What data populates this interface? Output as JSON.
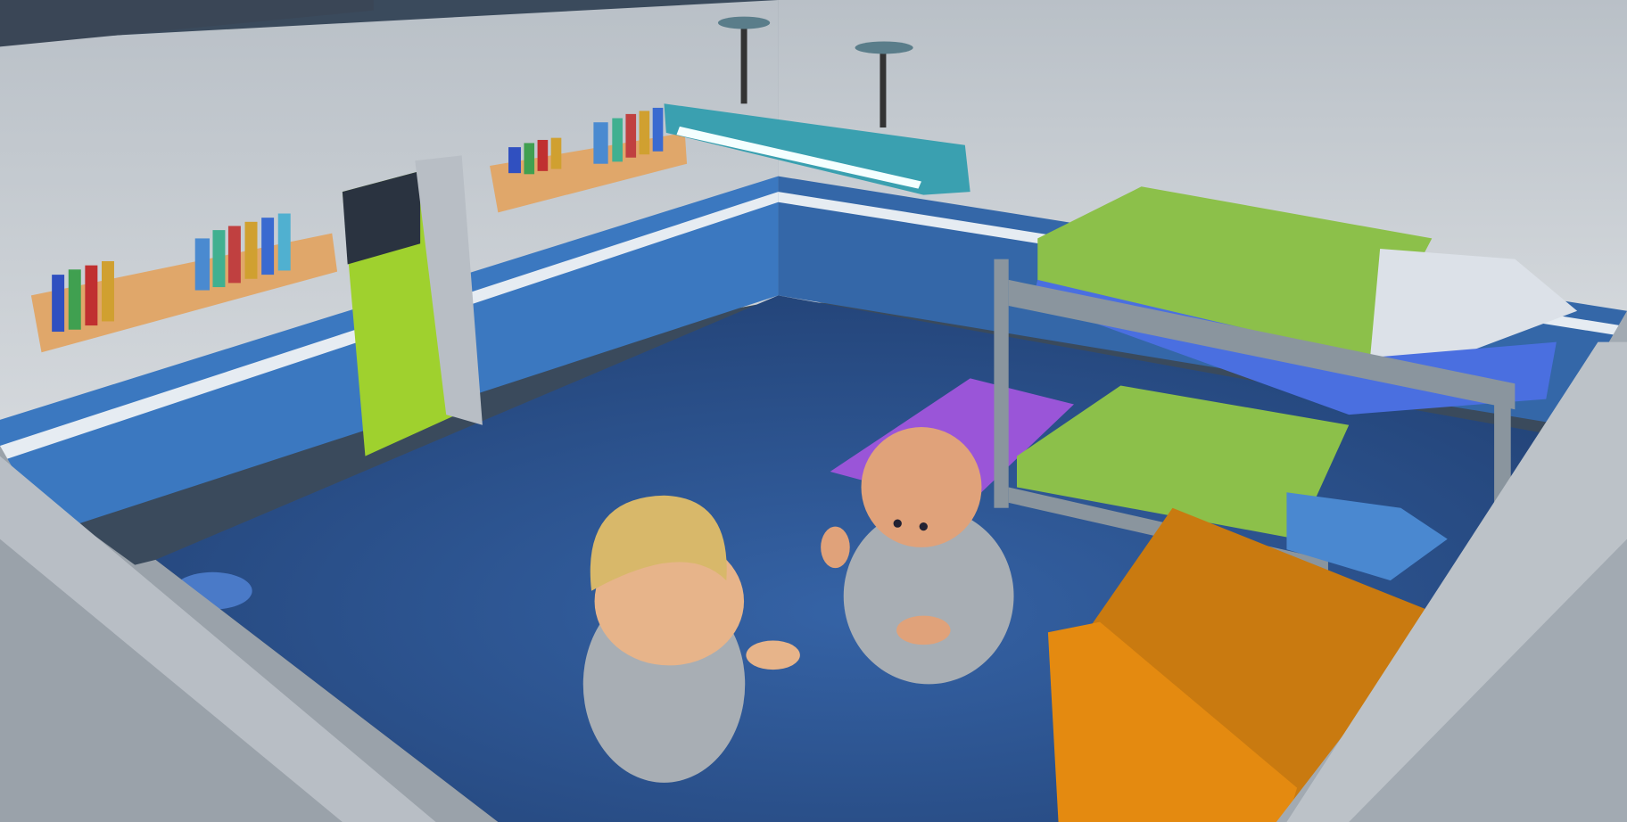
{
  "scene": {
    "type": "isometric prison cell",
    "colors": {
      "wall": "#c9ced3",
      "wall_stripe": "#3b78c0",
      "floor": "#2f5c9c",
      "bed_sheet": "#8cc04a",
      "mattress": "#4a6fe0",
      "desk": "#e48a10",
      "grass": "#9fd12e",
      "lamp": "#3aa0b0",
      "mat": "#9a55d8"
    },
    "characters": [
      {
        "name": "blond-inmate",
        "hair": "#d8b86a"
      },
      {
        "name": "bald-inmate",
        "skin": "#e0a27a"
      }
    ]
  }
}
